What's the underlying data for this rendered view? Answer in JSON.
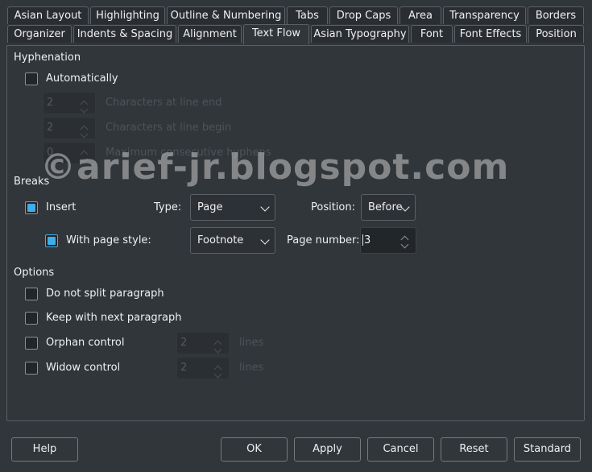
{
  "tabs_row1": [
    "Asian Layout",
    "Highlighting",
    "Outline & Numbering",
    "Tabs",
    "Drop Caps",
    "Area",
    "Transparency",
    "Borders"
  ],
  "tabs_row2": [
    "Organizer",
    "Indents & Spacing",
    "Alignment",
    "Text Flow",
    "Asian Typography",
    "Font",
    "Font Effects",
    "Position"
  ],
  "active_tab": "Text Flow",
  "hyphenation": {
    "title": "Hyphenation",
    "automatically": {
      "label": "Automatically",
      "checked": false
    },
    "chars_line_end": {
      "value": "2",
      "label": "Characters at line end"
    },
    "chars_line_begin": {
      "value": "2",
      "label": "Characters at line begin"
    },
    "max_hyphens": {
      "value": "0",
      "label": "Maximum consecutive hyphens"
    }
  },
  "breaks": {
    "title": "Breaks",
    "insert": {
      "label": "Insert",
      "checked": true
    },
    "type_label": "Type:",
    "type_value": "Page",
    "position_label": "Position:",
    "position_value": "Before",
    "page_style": {
      "label": "With page style:",
      "checked": true
    },
    "page_style_value": "Footnote",
    "page_number_label": "Page number:",
    "page_number_value": "3"
  },
  "options": {
    "title": "Options",
    "no_split": {
      "label": "Do not split paragraph",
      "checked": false
    },
    "keep_next": {
      "label": "Keep with next paragraph",
      "checked": false
    },
    "orphan": {
      "label": "Orphan control",
      "checked": false,
      "value": "2",
      "unit": "lines"
    },
    "widow": {
      "label": "Widow control",
      "checked": false,
      "value": "2",
      "unit": "lines"
    }
  },
  "buttons": {
    "help": "Help",
    "ok": "OK",
    "apply": "Apply",
    "cancel": "Cancel",
    "reset": "Reset",
    "standard": "Standard"
  },
  "watermark": "©arief-jr.blogspot.com"
}
